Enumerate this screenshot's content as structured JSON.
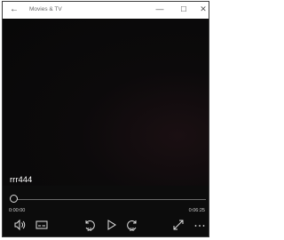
{
  "window": {
    "title": "Movies & TV"
  },
  "video": {
    "title": "rrr444",
    "current_time": "0:00:00",
    "total_time": "0:06:25",
    "progress": 0
  },
  "controls": {
    "skip_back_label": "10",
    "skip_forward_label": "30"
  },
  "icons": {
    "back": "back-arrow-icon",
    "minimize": "minimize-icon",
    "maximize": "maximize-icon",
    "close": "close-icon",
    "volume": "volume-icon",
    "subtitles": "subtitles-icon",
    "skip_back": "skip-back-icon",
    "play": "play-icon",
    "skip_forward": "skip-forward-icon",
    "fullscreen": "fullscreen-icon",
    "more": "more-icon"
  }
}
